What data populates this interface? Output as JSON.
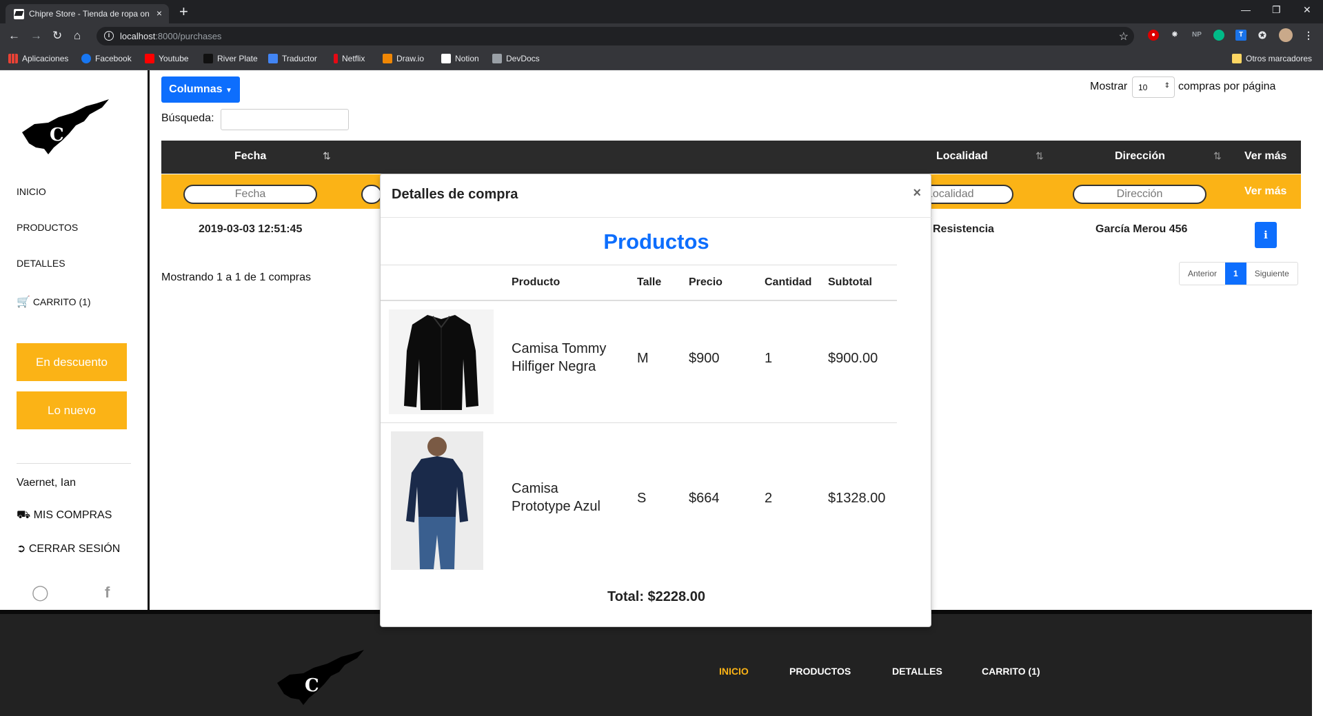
{
  "browser": {
    "tab_title": "Chipre Store - Tienda de ropa on",
    "tab_close": "×",
    "new_tab": "+",
    "url_host": "localhost",
    "url_path": ":8000/purchases",
    "bookmarks": [
      "Aplicaciones",
      "Facebook",
      "Youtube",
      "River Plate",
      "Traductor",
      "Netflix",
      "Draw.io",
      "Notion",
      "DevDocs"
    ],
    "other_bookmarks": "Otros marcadores",
    "ext_np": "NP"
  },
  "sidebar": {
    "nav": [
      "INICIO",
      "PRODUCTOS",
      "DETALLES",
      "CARRITO (1)"
    ],
    "promo_buttons": [
      "En descuento",
      "Lo nuevo"
    ],
    "user_name": "Vaernet, Ian",
    "actions": [
      "MIS COMPRAS",
      "CERRAR SESIÓN"
    ]
  },
  "toolbar": {
    "columns_button": "Columnas",
    "search_label": "Búsqueda:",
    "show_label": "Mostrar",
    "page_size": "10",
    "per_page_label": "compras por página"
  },
  "table": {
    "headers": [
      "Fecha",
      "Localidad",
      "Dirección",
      "Ver más"
    ],
    "filters": [
      "Fecha",
      "Localidad",
      "Dirección",
      "Ver más"
    ],
    "row": {
      "fecha": "2019-03-03 12:51:45",
      "localidad": "Resistencia",
      "direccion": "García Merou 456",
      "info": "i"
    },
    "showing": "Mostrando 1 a 1 de 1 compras",
    "pager": [
      "Anterior",
      "1",
      "Siguiente"
    ]
  },
  "modal": {
    "title": "Detalles de compra",
    "close": "×",
    "heading": "Productos",
    "columns": [
      "Producto",
      "Talle",
      "Precio",
      "Cantidad",
      "Subtotal"
    ],
    "items": [
      {
        "name": "Camisa Tommy Hilfiger Negra",
        "talle": "M",
        "precio": "$900",
        "cantidad": "1",
        "subtotal": "$900.00"
      },
      {
        "name": "Camisa Prototype Azul",
        "talle": "S",
        "precio": "$664",
        "cantidad": "2",
        "subtotal": "$1328.00"
      }
    ],
    "total": "Total: $2228.00"
  },
  "footer": {
    "nav": [
      "INICIO",
      "PRODUCTOS",
      "DETALLES",
      "CARRITO (1)"
    ]
  },
  "colors": {
    "accent": "#fbb316",
    "primary": "#0d6efd",
    "dark": "#2b2b2b"
  }
}
